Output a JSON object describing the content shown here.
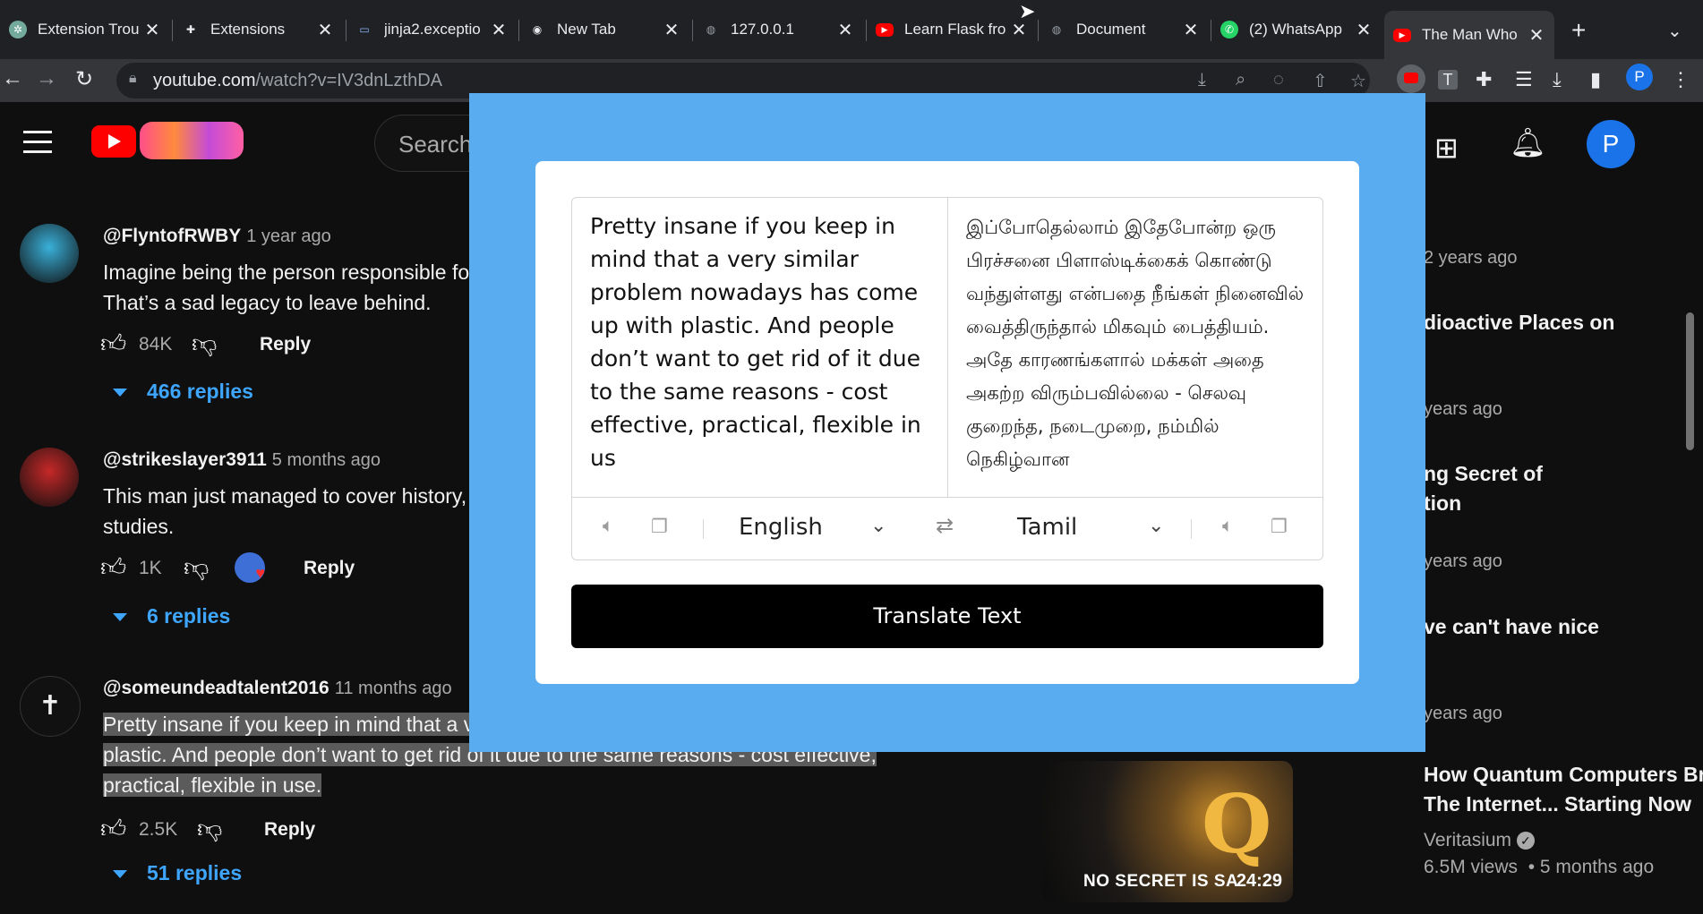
{
  "browser": {
    "tabs": [
      {
        "title": "Extension Trou",
        "icon": "chatgpt-icon",
        "color": "#74aa9c"
      },
      {
        "title": "Extensions",
        "icon": "puzzle-icon",
        "color": "#e8eaed"
      },
      {
        "title": "jinja2.exceptio",
        "icon": "terminal-icon",
        "color": "#8ab4f8"
      },
      {
        "title": "New Tab",
        "icon": "chrome-icon",
        "color": "#e8eaed"
      },
      {
        "title": "127.0.0.1",
        "icon": "globe-icon",
        "color": "#9aa0a6"
      },
      {
        "title": "Learn Flask fro",
        "icon": "youtube-icon",
        "color": "#ff0000"
      },
      {
        "title": "Document",
        "icon": "globe-icon",
        "color": "#9aa0a6"
      },
      {
        "title": "(2) WhatsApp",
        "icon": "whatsapp-icon",
        "color": "#25d366"
      },
      {
        "title": "The Man Who",
        "icon": "youtube-icon",
        "color": "#ff0000"
      }
    ],
    "active_tab_index": 8,
    "url_domain": "youtube.com",
    "url_path": "/watch?v=IV3dnLzthDA",
    "profile_letter": "P"
  },
  "youtube": {
    "search_placeholder": "Search",
    "avatar_letter": "P",
    "comments": [
      {
        "author": "@FlyntofRWBY",
        "time": "1 year ago",
        "lines": [
          "Imagine being the person responsible fo",
          "That’s a sad legacy to leave behind."
        ],
        "likes": "84K",
        "reply_label": "Reply",
        "replies": "466 replies",
        "avatar_color": "#3ab0d9"
      },
      {
        "author": "@strikeslayer3911",
        "time": "5 months ago",
        "lines": [
          "This man just managed to cover history,",
          "studies."
        ],
        "likes": "1K",
        "reply_label": "Reply",
        "replies": "6 replies",
        "avatar_color": "#c62828"
      },
      {
        "author": "@someundeadtalent2016",
        "time": "11 months ago",
        "lines": [
          "Pretty insane if you keep in mind that a v",
          "plastic. And people don’t want to get rid of it due to the same reasons - cost effective,",
          "practical, flexible in use."
        ],
        "likes": "2.5K",
        "reply_label": "Reply",
        "replies": "51 replies",
        "avatar_color": "#111111"
      }
    ],
    "recommendations": {
      "fragments": [
        {
          "kind": "meta",
          "text": "2 years ago"
        },
        {
          "kind": "title",
          "text": "dioactive Places on"
        },
        {
          "kind": "meta",
          "text": "years ago"
        },
        {
          "kind": "title",
          "text": "ng Secret of"
        },
        {
          "kind": "title",
          "text": "tion"
        },
        {
          "kind": "meta",
          "text": "years ago"
        },
        {
          "kind": "title",
          "text": "ve can't have nice"
        },
        {
          "kind": "meta",
          "text": "years ago"
        }
      ],
      "video": {
        "title_line1": "How Quantum Computers Break",
        "title_line2": "The Internet... Starting Now",
        "channel": "Veritasium",
        "views": "6.5M views",
        "age": "• 5 months ago",
        "thumb_caption": "NO SECRET IS SA",
        "duration": "24:29"
      }
    }
  },
  "translator": {
    "source_text": "Pretty insane if you keep in mind that a very similar problem nowadays has come up with plastic. And people don’t want to get rid of it due to the same reasons - cost effective, practical, flexible in us",
    "target_text": "இப்போதெல்லாம் இதேபோன்ற ஒரு பிரச்சனை பிளாஸ்டிக்கைக் கொண்டு வந்துள்ளது என்பதை நீங்கள் நினைவில் வைத்திருந்தால் மிகவும் பைத்தியம். அதே காரணங்களால் மக்கள் அதை அகற்ற விரும்பவில்லை - செலவு குறைந்த, நடைமுறை, நம்மில் நெகிழ்வான",
    "source_lang": "English",
    "target_lang": "Tamil",
    "button_label": "Translate Text",
    "overlay_color": "#5aacf0"
  }
}
